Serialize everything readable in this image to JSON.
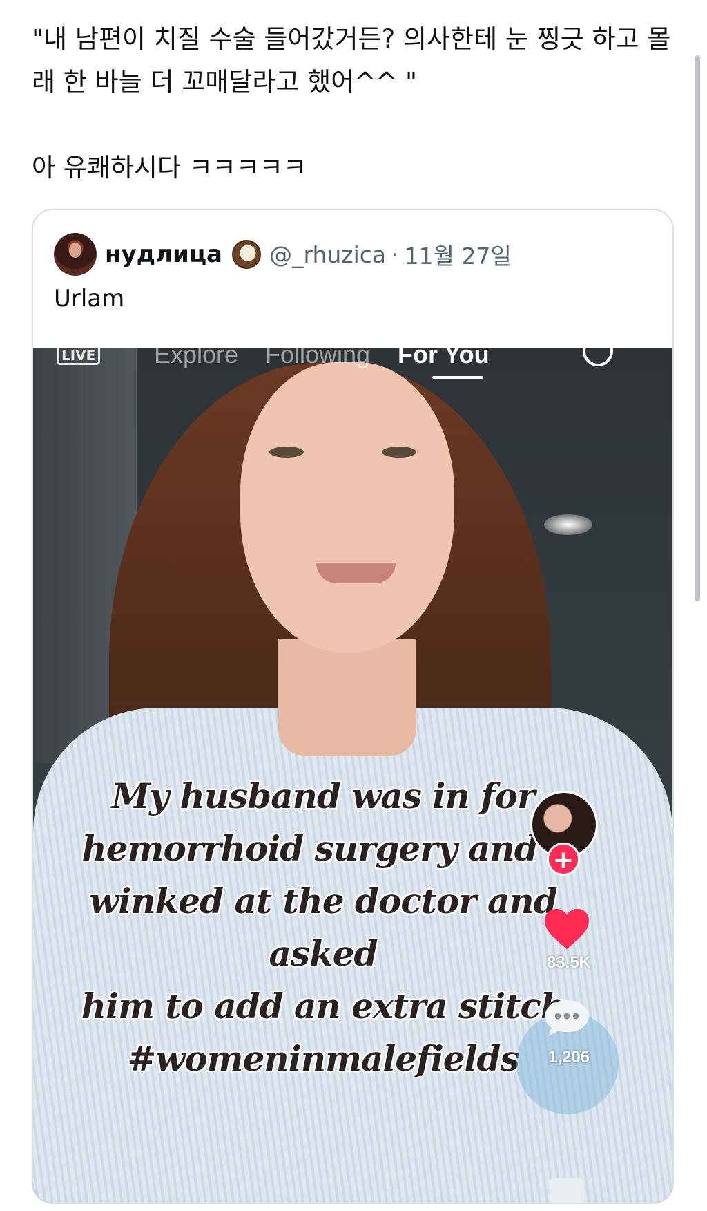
{
  "tweet": {
    "text": "\"내 남편이 치질 수술 들어갔거든? 의사한테 눈 찡긋 하고 몰래 한 바늘 더 꼬매달라고 했어^^ \"\n\n아 유쾌하시다 ㅋㅋㅋㅋㅋ"
  },
  "quote": {
    "display_name": "нудлица",
    "handle": "@_rhuzica",
    "separator": "·",
    "date": "11월 27일",
    "body": "Urlam"
  },
  "media": {
    "nav": {
      "live_label": "LIVE",
      "tabs": [
        {
          "label": "Explore"
        },
        {
          "label": "Following"
        },
        {
          "label": "For You"
        }
      ]
    },
    "caption": "My husband was in for\nhemorrhoid surgery and I\nwinked at the doctor and asked\nhim to add an extra stitch\n#womeninmalefields",
    "follow_symbol": "+",
    "likes": "83.5K",
    "comments": "1,206",
    "colors": {
      "like": "#fe2c55",
      "follow": "#fe2c55"
    }
  },
  "icons": [
    "coconut-icon",
    "search-icon",
    "heart-icon",
    "comment-icon",
    "plus-icon"
  ]
}
